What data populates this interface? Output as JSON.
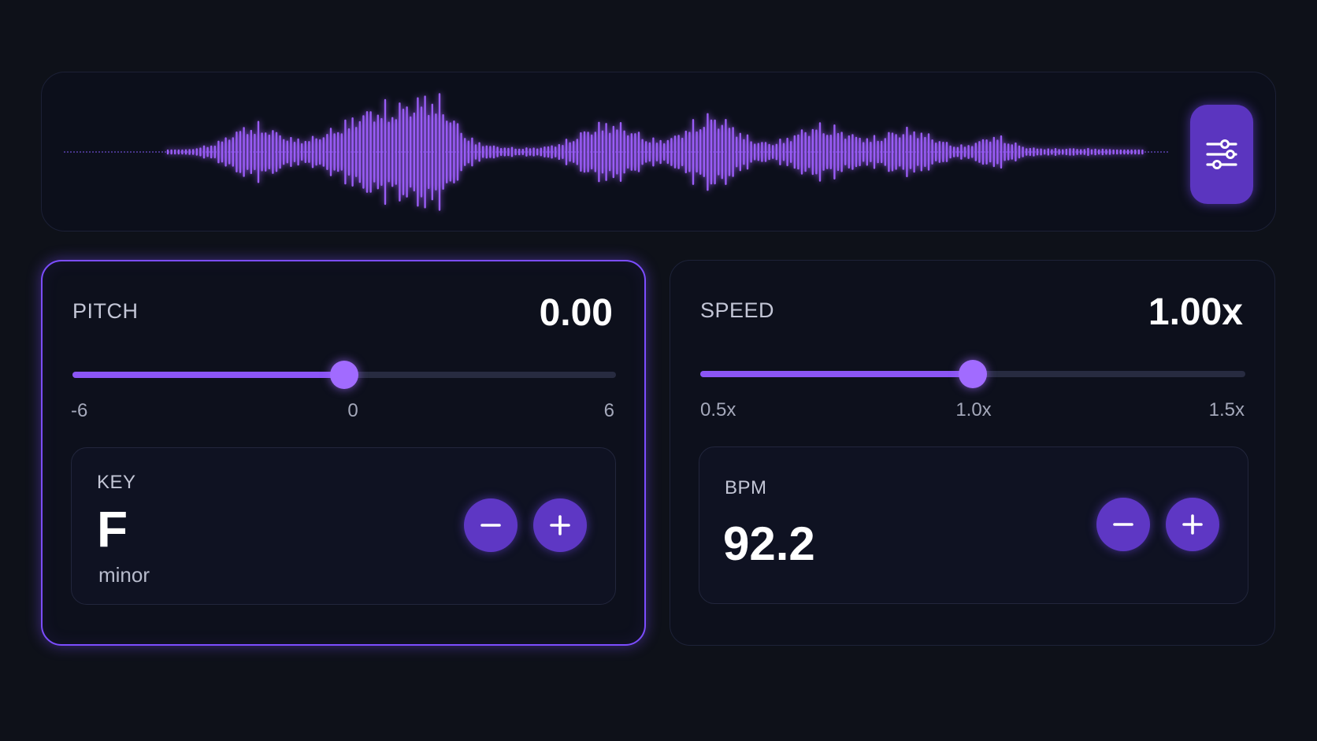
{
  "colors": {
    "background": "#0e1119",
    "accent": "#7c4dff",
    "accent_fill": "#8b55f5",
    "thumb": "#a16bff",
    "button": "#5e37c4"
  },
  "waveform": {
    "settings_icon": "sliders-icon"
  },
  "pitch": {
    "label": "PITCH",
    "value": "0.00",
    "slider": {
      "min": -6,
      "max": 6,
      "value": 0
    },
    "ticks": {
      "min": "-6",
      "mid": "0",
      "max": "6"
    },
    "key": {
      "label": "KEY",
      "note": "F",
      "mode": "minor"
    },
    "decrement_icon": "minus-icon",
    "increment_icon": "plus-icon"
  },
  "speed": {
    "label": "SPEED",
    "value": "1.00x",
    "slider": {
      "min": 0.5,
      "max": 1.5,
      "value": 1.0
    },
    "ticks": {
      "min": "0.5x",
      "mid": "1.0x",
      "max": "1.5x"
    },
    "bpm": {
      "label": "BPM",
      "value": "92.2"
    },
    "decrement_icon": "minus-icon",
    "increment_icon": "plus-icon"
  }
}
